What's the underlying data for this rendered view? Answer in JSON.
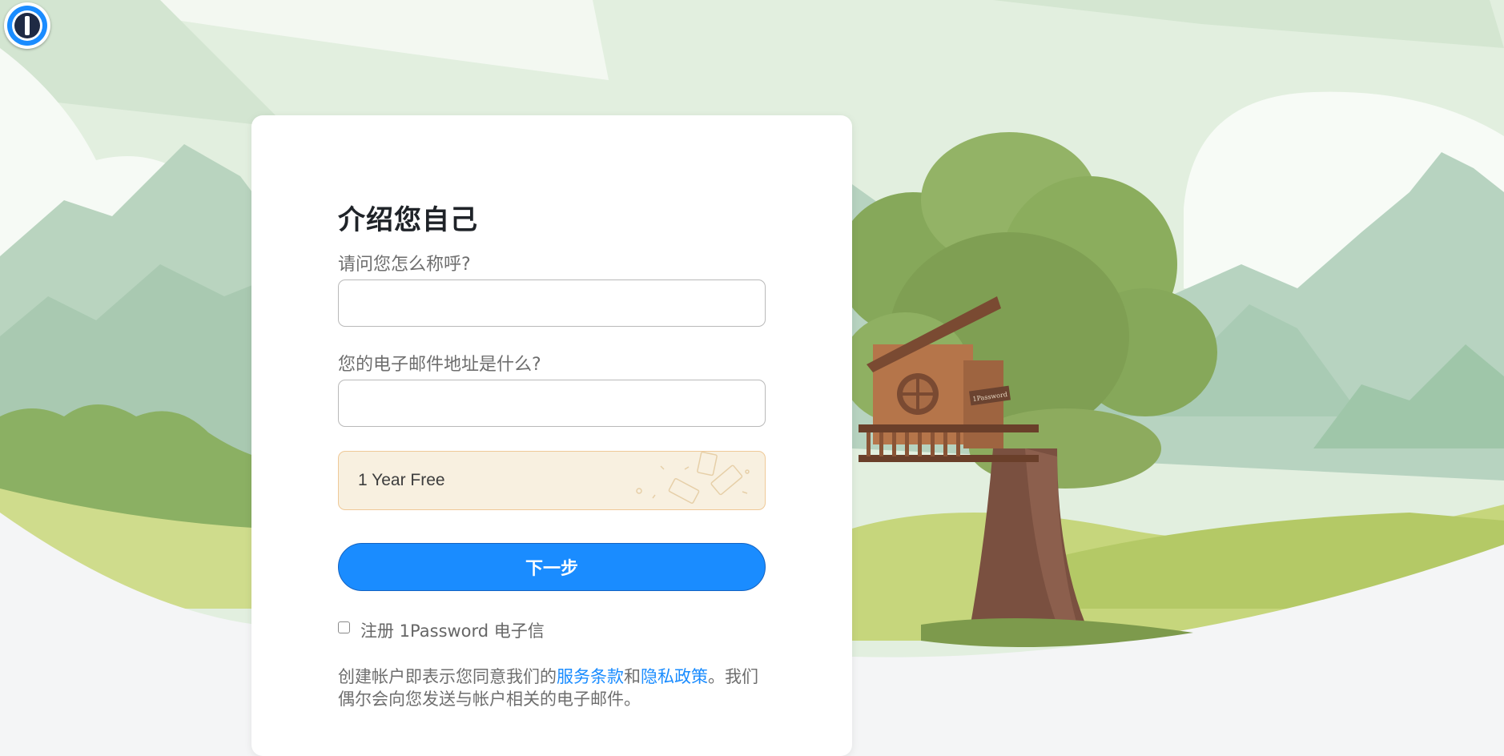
{
  "page": {
    "title": "介绍您自己",
    "name_label": "请问您怎么称呼?",
    "name_value": "",
    "email_label": "您的电子邮件地址是什么?",
    "email_value": "",
    "promo_text": "1 Year Free",
    "next_button": "下一步",
    "newsletter_label": "注册 1Password 电子信",
    "newsletter_checked": false,
    "legal": {
      "prefix": "创建帐户即表示您同意我们的",
      "terms_link": "服务条款",
      "and": "和",
      "privacy_link": "隐私政策",
      "suffix": "。我们偶尔会向您发送与帐户相关的电子邮件。"
    },
    "sign_text": "1Password"
  },
  "colors": {
    "accent": "#1a8cff",
    "promo_bg": "#f8f0e0",
    "promo_border": "#efc998"
  },
  "icons": {
    "logo": "1password-logo-icon",
    "promo": "coupon-tickets-icon"
  }
}
